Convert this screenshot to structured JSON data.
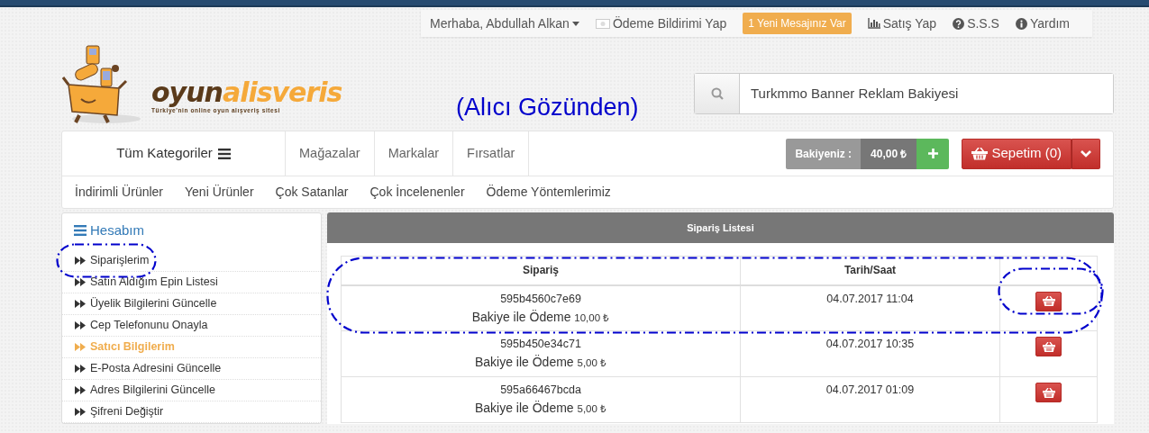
{
  "top_links": {
    "greeting": "Merhaba, Abdullah Alkan",
    "payment_notice": "Ödeme Bildirimi Yap",
    "messages_badge": "1 Yeni Mesajınız Var",
    "sell": "Satış Yap",
    "faq": "S.S.S",
    "help": "Yardım"
  },
  "logo": {
    "word_1": "oyun",
    "word_2": "alisveris",
    "tagline": "Türkiye'nin online oyun alışveriş sitesi"
  },
  "annotation_label": "(Alıcı Gözünden)",
  "search": {
    "value": "Turkmmo Banner Reklam Bakiyesi"
  },
  "nav": {
    "categories": "Tüm Kategoriler",
    "links": [
      "Mağazalar",
      "Markalar",
      "Fırsatlar"
    ],
    "balance_label": "Bakiyeniz :",
    "balance_value": "40,00 ₺",
    "cart": "Sepetim (0)"
  },
  "subnav": [
    "İndirimli Ürünler",
    "Yeni Ürünler",
    "Çok Satanlar",
    "Çok İncelenenler",
    "Ödeme Yöntemlerimiz"
  ],
  "sidebar": {
    "title": "Hesabım",
    "items": [
      {
        "label": "Siparişlerim",
        "selected": false
      },
      {
        "label": "Satın Aldığım Epin Listesi",
        "selected": false
      },
      {
        "label": "Üyelik Bilgilerini Güncelle",
        "selected": false
      },
      {
        "label": "Cep Telefonunu Onayla",
        "selected": false
      },
      {
        "label": "Satıcı Bilgilerim",
        "selected": true
      },
      {
        "label": "E-Posta Adresini Güncelle",
        "selected": false
      },
      {
        "label": "Adres Bilgilerini Güncelle",
        "selected": false
      },
      {
        "label": "Şifreni Değiştir",
        "selected": false
      }
    ]
  },
  "orders": {
    "title": "Sipariş Listesi",
    "columns": [
      "Sipariş",
      "Tarih/Saat"
    ],
    "rows": [
      {
        "order_id": "595b4560c7e69",
        "payment": "Bakiye ile Ödeme",
        "amount": "10,00 ₺",
        "datetime": "04.07.2017 11:04"
      },
      {
        "order_id": "595b450e34c71",
        "payment": "Bakiye ile Ödeme",
        "amount": "5,00 ₺",
        "datetime": "04.07.2017 10:35"
      },
      {
        "order_id": "595a66467bcda",
        "payment": "Bakiye ile Ödeme",
        "amount": "5,00 ₺",
        "datetime": "04.07.2017 01:09"
      }
    ]
  }
}
